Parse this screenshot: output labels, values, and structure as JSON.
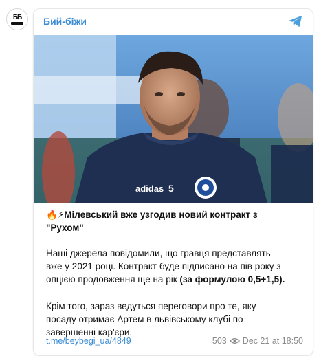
{
  "channel": {
    "name": "Бий-біжи",
    "avatar_text": "ББ"
  },
  "post": {
    "title_emoji": "🔥⚡",
    "title_line1": "Мілевський вже узгодив новий контракт з",
    "title_line2": "\"Рухом\"",
    "p1_line1": "Наші джерела повідомили, що гравця представлять",
    "p1_line2": "вже у 2021 році. Контракт буде підписано на пів року з",
    "p1_line3_plain": "опцією продовження ще на рік ",
    "p1_line3_bold": "(за формулою 0,5+1,5).",
    "p2_line1": "Крім того, зараз ведуться переговори про те, яку",
    "p2_line2": "посаду отримає Артем в львівському клубі по",
    "p2_line3": "завершенні кар'єри.",
    "link": "t.me/beybegi_ua/4849",
    "views": "503",
    "time": "Dec 21 at 18:50"
  },
  "photo": {
    "shirt_brand": "adidas",
    "shirt_number": "5"
  },
  "colors": {
    "accent": "#3a8bd4",
    "meta": "#8a8a8a"
  }
}
